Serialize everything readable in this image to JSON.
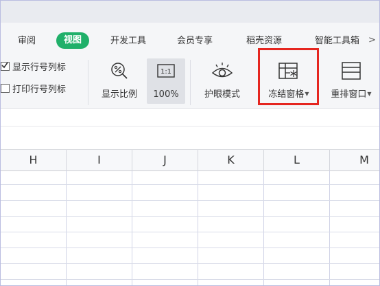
{
  "menu": {
    "tabs": [
      {
        "label": "审阅",
        "active": false
      },
      {
        "label": "视图",
        "active": true
      },
      {
        "label": "开发工具",
        "active": false
      },
      {
        "label": "会员专享",
        "active": false
      },
      {
        "label": "稻壳资源",
        "active": false
      },
      {
        "label": "智能工具箱",
        "active": false
      }
    ],
    "more_arrow": ">"
  },
  "ribbon": {
    "show_row_col_headers": {
      "label": "显示行号列标",
      "checked": true
    },
    "print_row_col_headers": {
      "label": "打印行号列标",
      "checked": false
    },
    "zoom_ratio": {
      "label": "显示比例",
      "icon": "zoom-percent-icon"
    },
    "zoom_100": {
      "label": "100%",
      "icon_text": "1:1"
    },
    "eye_protection": {
      "label": "护眼模式",
      "icon": "eye-icon"
    },
    "freeze_panes": {
      "label": "冻结窗格",
      "icon": "freeze-grid-icon",
      "highlighted": true
    },
    "arrange_windows": {
      "label": "重排窗口",
      "icon": "window-arrange-icon"
    }
  },
  "columns": [
    "H",
    "I",
    "J",
    "K",
    "L",
    "M"
  ],
  "colors": {
    "accent_green": "#20b06a",
    "highlight_red": "#e52620"
  }
}
